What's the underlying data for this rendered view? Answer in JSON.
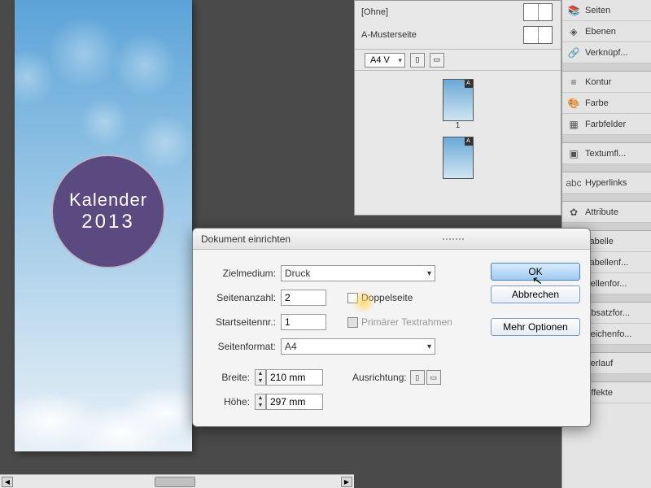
{
  "document": {
    "title_line1": "Kalender",
    "title_line2": "2013"
  },
  "pages_panel": {
    "masters": [
      "[Ohne]",
      "A-Musterseite"
    ],
    "format": "A4 V",
    "page_numbers": [
      "1"
    ],
    "thumb_badge": "A"
  },
  "sidebar": [
    {
      "icon": "📚",
      "label": "Seiten"
    },
    {
      "icon": "◈",
      "label": "Ebenen"
    },
    {
      "icon": "🔗",
      "label": "Verknüpf..."
    },
    {
      "sep": true
    },
    {
      "icon": "≡",
      "label": "Kontur"
    },
    {
      "icon": "🎨",
      "label": "Farbe"
    },
    {
      "icon": "▦",
      "label": "Farbfelder"
    },
    {
      "sep": true
    },
    {
      "icon": "▣",
      "label": "Textumfl..."
    },
    {
      "sep": true
    },
    {
      "icon": "abc",
      "label": "Hyperlinks"
    },
    {
      "sep": true
    },
    {
      "icon": "✿",
      "label": "Attribute"
    },
    {
      "sep": true
    },
    {
      "icon": "▦",
      "label": "Tabelle"
    },
    {
      "icon": "▤",
      "label": "Tabellenf..."
    },
    {
      "icon": "▥",
      "label": "Zellenfor..."
    },
    {
      "sep": true
    },
    {
      "icon": "¶",
      "label": "Absatzfor..."
    },
    {
      "icon": "A",
      "label": "Zeichenfo..."
    },
    {
      "sep": true
    },
    {
      "icon": "▬",
      "label": "Verlauf"
    },
    {
      "sep": true
    },
    {
      "icon": "fx",
      "label": "Effekte"
    }
  ],
  "dialog": {
    "title": "Dokument einrichten",
    "labels": {
      "zielmedium": "Zielmedium:",
      "seitenanzahl": "Seitenanzahl:",
      "startseitennr": "Startseitennr.:",
      "seitenformat": "Seitenformat:",
      "breite": "Breite:",
      "hoehe": "Höhe:",
      "ausrichtung": "Ausrichtung:",
      "doppelseite": "Doppelseite",
      "primaer": "Primärer Textrahmen"
    },
    "values": {
      "zielmedium": "Druck",
      "seitenanzahl": "2",
      "startseitennr": "1",
      "seitenformat": "A4",
      "breite": "210 mm",
      "hoehe": "297 mm"
    },
    "buttons": {
      "ok": "OK",
      "cancel": "Abbrechen",
      "more": "Mehr Optionen"
    }
  }
}
